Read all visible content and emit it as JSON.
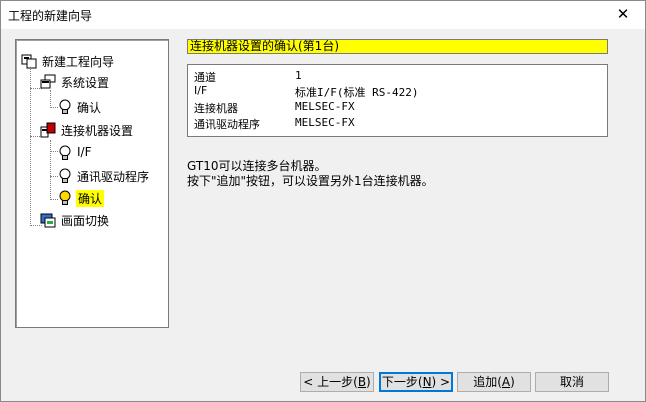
{
  "window": {
    "title": "工程的新建向导",
    "close_glyph": "✕"
  },
  "tree": {
    "root": {
      "label": "新建工程向导",
      "icon": "project-wizard-icon"
    },
    "system_settings": {
      "label": "系统设置",
      "icon": "system-settings-icon"
    },
    "system_confirm": {
      "label": "确认",
      "icon": "lightbulb-icon"
    },
    "connected_device": {
      "label": "连接机器设置",
      "icon": "device-connection-icon"
    },
    "if": {
      "label": "I/F",
      "icon": "lightbulb-icon"
    },
    "driver": {
      "label": "通讯驱动程序",
      "icon": "lightbulb-icon"
    },
    "device_confirm": {
      "label": "确认",
      "icon": "lightbulb-lit-icon",
      "selected": true
    },
    "screen_switch": {
      "label": "画面切换",
      "icon": "screen-switch-icon"
    }
  },
  "main": {
    "header": "连接机器设置的确认(第1台)",
    "info_rows": [
      {
        "key": "通道",
        "value": "1"
      },
      {
        "key": "I/F",
        "value": "标准I/F(标准 RS-422)"
      },
      {
        "key": "连接机器",
        "value": "MELSEC-FX"
      },
      {
        "key": "通讯驱动程序",
        "value": "MELSEC-FX"
      }
    ],
    "message_line1": "GT10可以连接多台机器。",
    "message_line2": "按下\"追加\"按钮，可以设置另外1台连接机器。"
  },
  "buttons": {
    "back": {
      "prefix": "< 上一步(",
      "key": "B",
      "suffix": ")"
    },
    "next": {
      "prefix": "下一步(",
      "key": "N",
      "suffix": ") >"
    },
    "add": {
      "prefix": "追加(",
      "key": "A",
      "suffix": ")"
    },
    "cancel": {
      "label": "取消"
    }
  },
  "colors": {
    "highlight": "#ffff00",
    "default_button_border": "#0078d7"
  }
}
